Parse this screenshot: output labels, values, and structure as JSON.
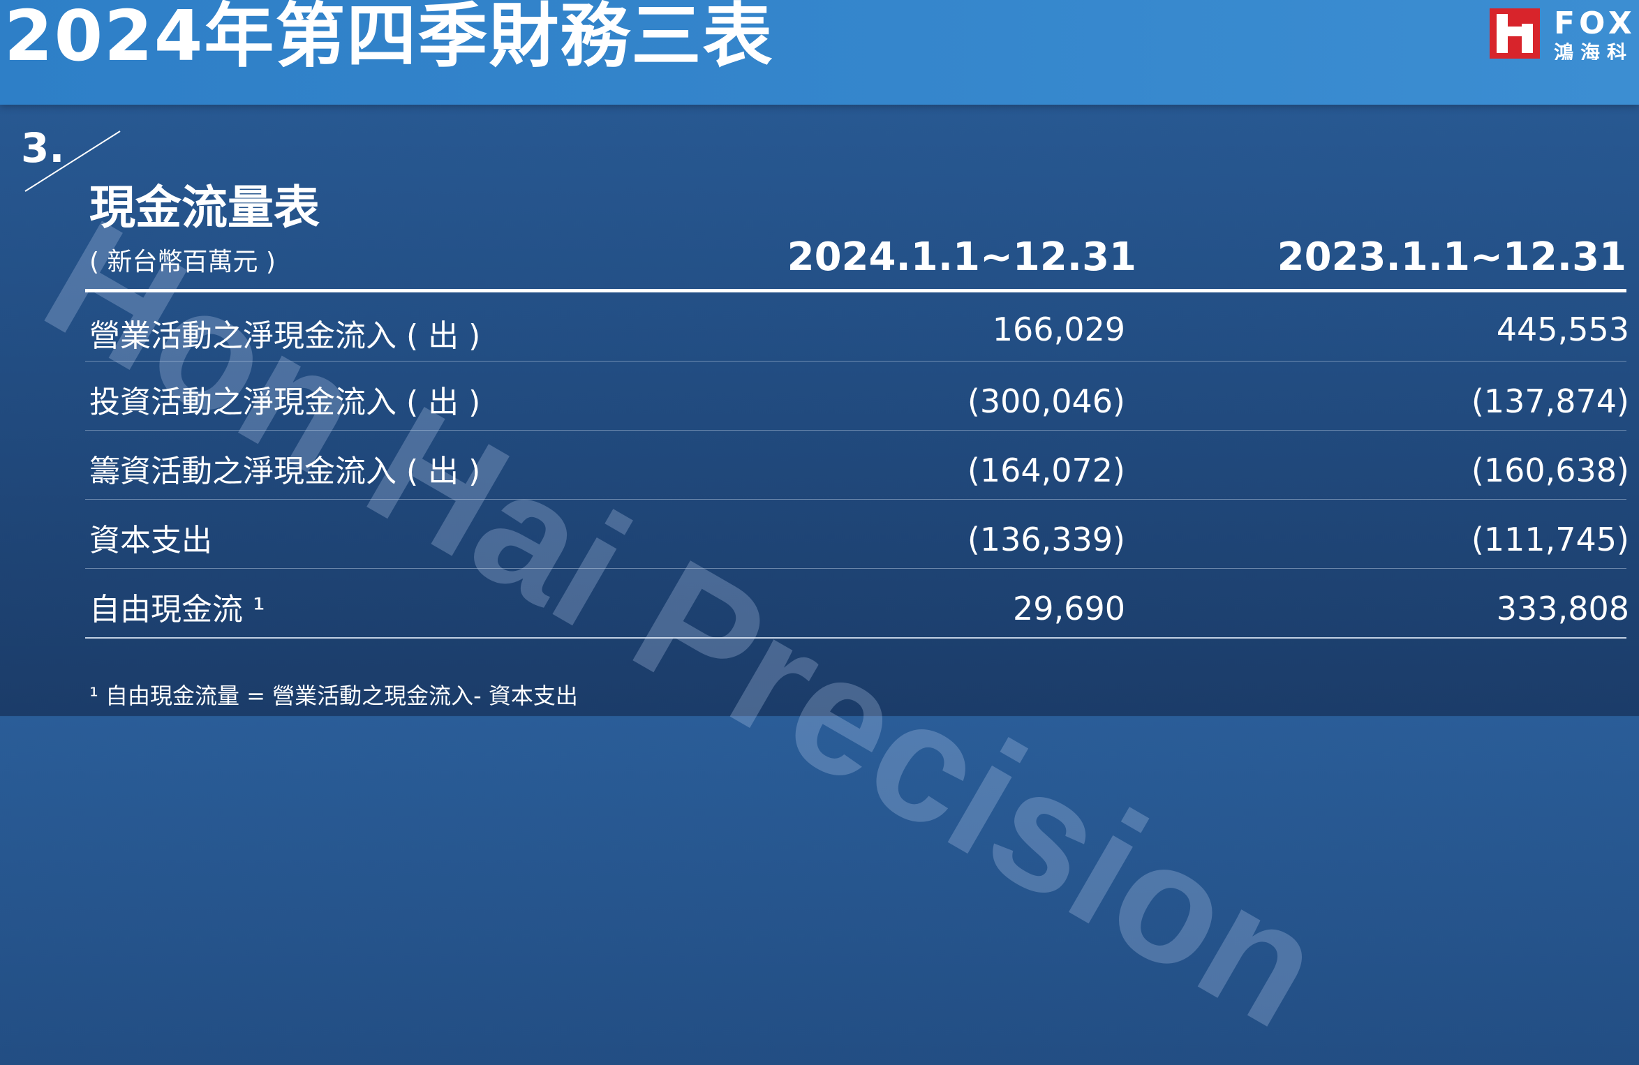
{
  "header": {
    "title": "2024年第四季財務三表",
    "logo_brand": "FOX",
    "logo_sub": "鴻海科",
    "accent": "#3586cc",
    "logo_red": "#d8242b"
  },
  "section": {
    "number": "3.",
    "title": "現金流量表",
    "unit": "( 新台幣百萬元 )"
  },
  "columns": [
    "2024.1.1~12.31",
    "2023.1.1~12.31"
  ],
  "rows": [
    {
      "label": "營業活動之淨現金流入 ( 出 )",
      "v2024": "166,029",
      "v2023": "445,553"
    },
    {
      "label": "投資活動之淨現金流入 ( 出 )",
      "v2024": "(300,046)",
      "v2023": "(137,874)"
    },
    {
      "label": "籌資活動之淨現金流入 ( 出 )",
      "v2024": "(164,072)",
      "v2023": "(160,638)"
    },
    {
      "label": "資本支出",
      "v2024": "(136,339)",
      "v2023": "(111,745)"
    },
    {
      "label": "自由現金流 ¹",
      "v2024": "29,690",
      "v2023": "333,808"
    }
  ],
  "footnote": "¹ 自由現金流量 = 營業活動之現金流入- 資本支出",
  "watermark": "Hon Hai Precision"
}
